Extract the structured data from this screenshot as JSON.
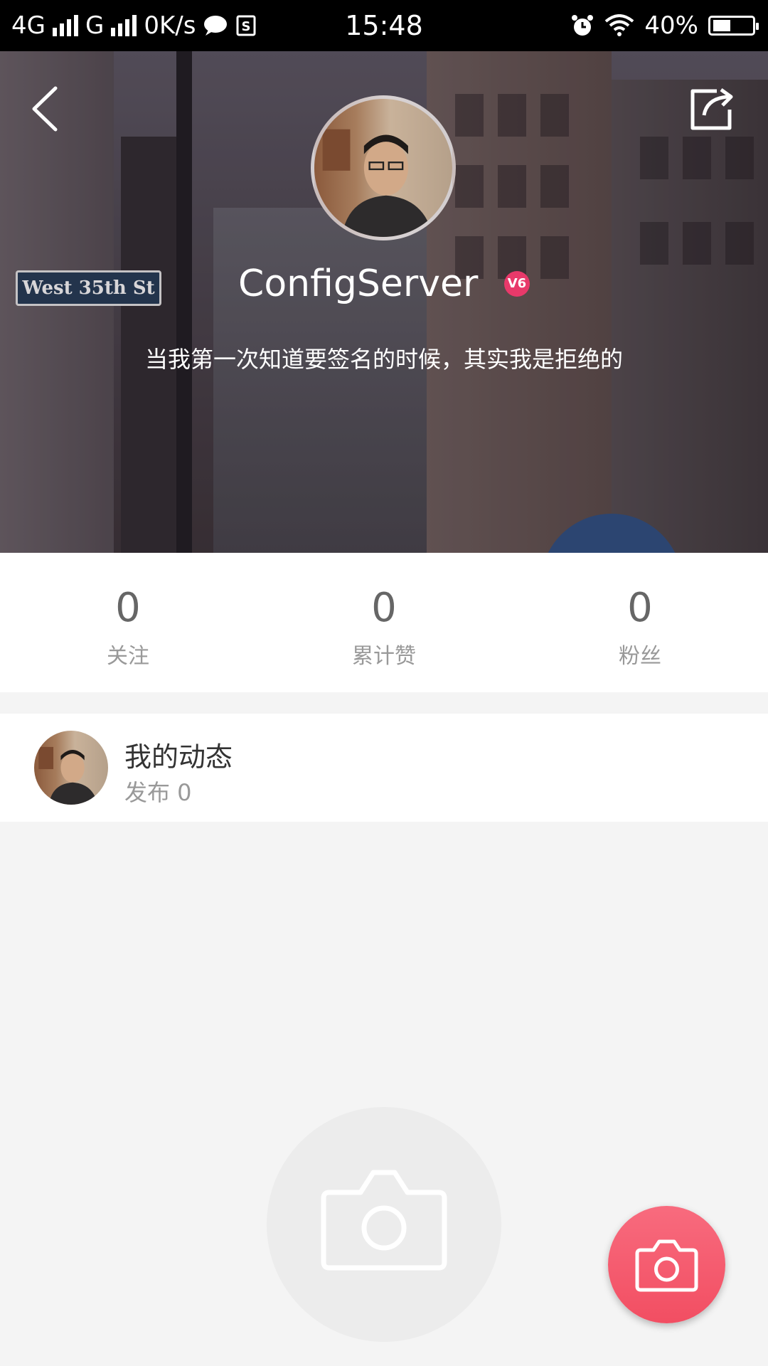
{
  "status_bar": {
    "network_label": "4G",
    "network2_label": "G",
    "speed": "0K/s",
    "time": "15:48",
    "battery": "40%"
  },
  "profile": {
    "username": "ConfigServer",
    "badge": "V6",
    "bio": "当我第一次知道要签名的时候，其实我是拒绝的",
    "street_sign": "West 35th St"
  },
  "stats": [
    {
      "value": "0",
      "label": "关注"
    },
    {
      "value": "0",
      "label": "累计赞"
    },
    {
      "value": "0",
      "label": "粉丝"
    }
  ],
  "moments": {
    "title": "我的动态",
    "subtitle": "发布 0"
  },
  "icons": {
    "back": "back-chevron-icon",
    "share": "share-icon",
    "camera": "camera-icon"
  },
  "colors": {
    "accent": "#f24e62",
    "badge": "#e8396a"
  }
}
